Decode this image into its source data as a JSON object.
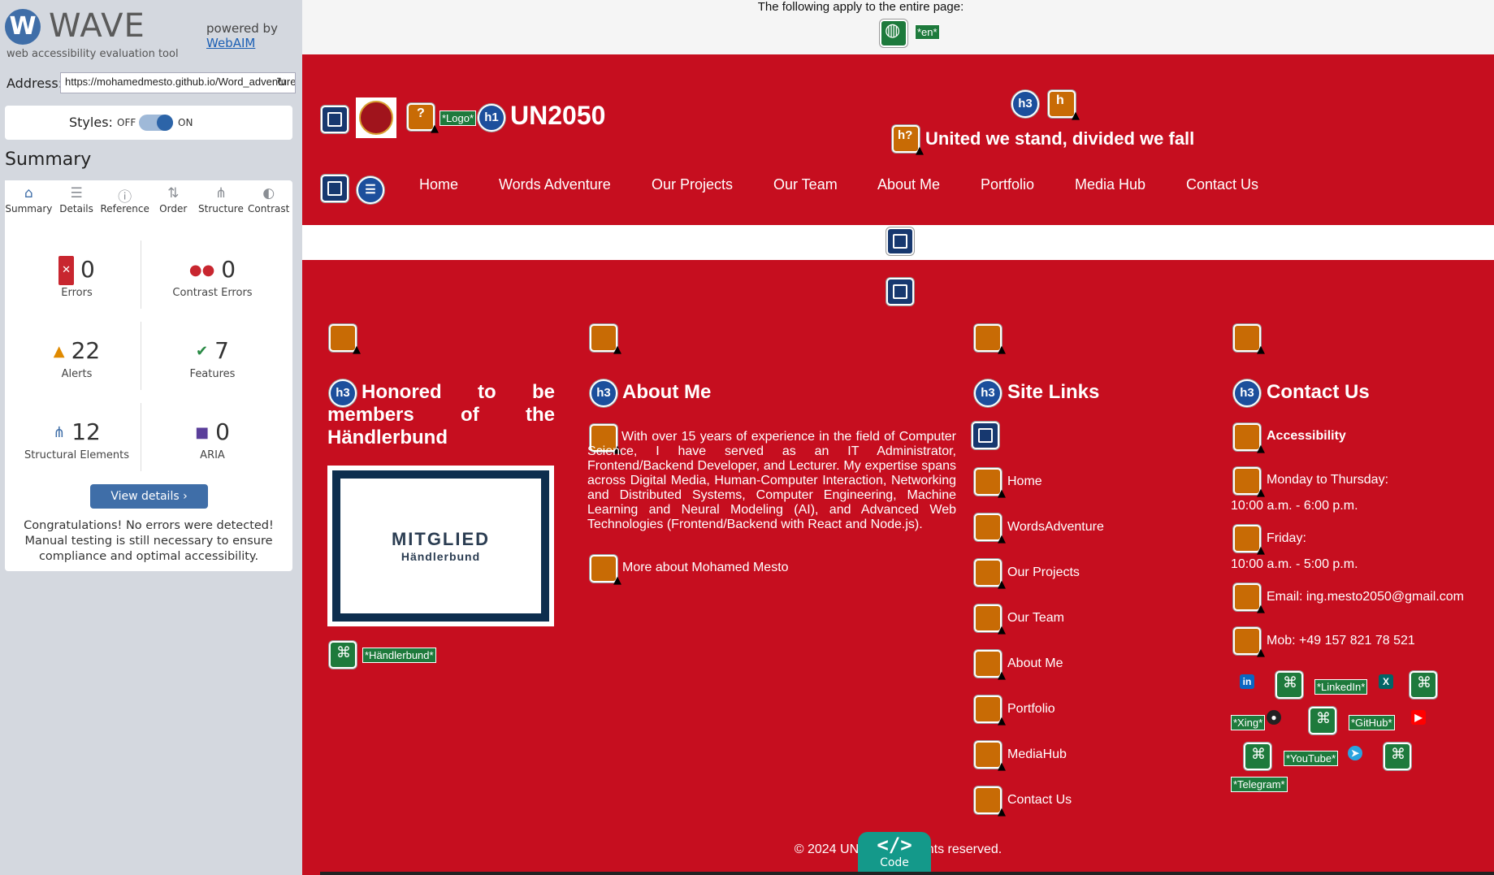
{
  "wave": {
    "title": "WAVE",
    "logo_letter": "W",
    "tagline": "web accessibility evaluation tool",
    "powered_by": "powered by",
    "webaim_link": "WebAIM",
    "address_label": "Address:",
    "address_value": "https://mohamedmesto.github.io/Word_adventure/",
    "styles_label": "Styles:",
    "styles_off": "OFF",
    "styles_on": "ON",
    "summary_heading": "Summary",
    "tabs": [
      {
        "label": "Summary",
        "icon": "home-icon",
        "glyph": "⌂"
      },
      {
        "label": "Details",
        "icon": "list-icon",
        "glyph": "☰"
      },
      {
        "label": "Reference",
        "icon": "info-icon",
        "glyph": "ⓘ"
      },
      {
        "label": "Order",
        "icon": "order-icon",
        "glyph": "⇅"
      },
      {
        "label": "Structure",
        "icon": "structure-icon",
        "glyph": "⋔"
      },
      {
        "label": "Contrast",
        "icon": "contrast-icon",
        "glyph": "◐"
      }
    ],
    "stats": {
      "errors": {
        "value": "0",
        "label": "Errors"
      },
      "contrast_errors": {
        "value": "0",
        "label": "Contrast Errors"
      },
      "alerts": {
        "value": "22",
        "label": "Alerts"
      },
      "features": {
        "value": "7",
        "label": "Features"
      },
      "structural": {
        "value": "12",
        "label": "Structural Elements"
      },
      "aria": {
        "value": "0",
        "label": "ARIA"
      }
    },
    "view_details": "View details ›",
    "congrats": "Congratulations! No errors were detected! Manual testing is still necessary to ensure compliance and optimal accessibility.",
    "colors": {
      "accent": "#3f6ea8",
      "error": "#c8262f",
      "alert": "#e08a00",
      "feature": "#2a8a45"
    }
  },
  "page": {
    "notice": "The following apply to the entire page:",
    "lang_tag": "*en*",
    "logo_tag": "*Logo*",
    "site_title": "UN2050",
    "slogan": "United we stand, divided we fall",
    "nav": [
      "Home",
      "Words Adventure",
      "Our Projects",
      "Our Team",
      "About Me",
      "Portfolio",
      "Media Hub",
      "Contact Us"
    ],
    "col1": {
      "heading": "Honored to be members of the Händlerbund",
      "badge_main": "MITGLIED",
      "badge_sub": "Händlerbund",
      "link_tag": "*Händlerbund*"
    },
    "col2": {
      "heading": "About Me",
      "paragraph": "With over 15 years of experience in the field of Computer Science, I have served as an IT Administrator, Frontend/Backend Developer, and Lecturer. My expertise spans across Digital Media, Human-Computer Interaction, Networking and Distributed Systems, Computer Engineering, Machine Learning and Neural Modeling (AI), and Advanced Web Technologies (Frontend/Backend with React and Node.js).",
      "more_link": "More about Mohamed Mesto"
    },
    "col3": {
      "heading": "Site Links",
      "links": [
        "Home",
        "WordsAdventure",
        "Our Projects",
        "Our Team",
        "About Me",
        "Portfolio",
        "MediaHub",
        "Contact Us"
      ]
    },
    "col4": {
      "heading": "Contact Us",
      "accessibility": "Accessibility",
      "mon_thu": "Monday to Thursday:",
      "mon_thu_hours": "10:00 a.m. - 6:00 p.m.",
      "friday": "Friday:",
      "friday_hours": "10:00 a.m. - 5:00 p.m.",
      "email": "Email: ing.mesto2050@gmail.com",
      "mob": "Mob: +49 157 821 78 521",
      "social_tags": [
        "*LinkedIn*",
        "*Xing*",
        "*GitHub*",
        "*YouTube*",
        "*Telegram*"
      ]
    },
    "footer": "© 2024 UN2050. All rights reserved.",
    "code_button": "Code",
    "code_symbol": "</>",
    "colors": {
      "background": "#c60e1f",
      "band": "#ffffff"
    }
  }
}
